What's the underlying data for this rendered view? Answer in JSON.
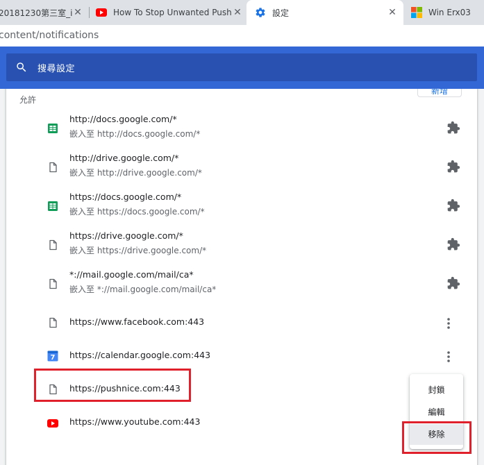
{
  "tabs": [
    {
      "title": "20181230第三室_i",
      "active": false
    },
    {
      "title": "How To Stop Unwanted Push",
      "active": false
    },
    {
      "title": "設定",
      "active": true
    },
    {
      "title": "Win Erx03",
      "active": false
    }
  ],
  "address_bar": {
    "url": "content/notifications"
  },
  "search": {
    "placeholder": "搜尋設定"
  },
  "section": {
    "label": "允許",
    "add_button": "新增"
  },
  "sites": [
    {
      "url": "http://docs.google.com/*",
      "sub": "嵌入至 http://docs.google.com/*",
      "icon": "google-sheets-icon",
      "action": "extension-icon"
    },
    {
      "url": "http://drive.google.com/*",
      "sub": "嵌入至 http://drive.google.com/*",
      "icon": "page-icon",
      "action": "extension-icon"
    },
    {
      "url": "https://docs.google.com/*",
      "sub": "嵌入至 https://docs.google.com/*",
      "icon": "google-sheets-icon",
      "action": "extension-icon"
    },
    {
      "url": "https://drive.google.com/*",
      "sub": "嵌入至 https://drive.google.com/*",
      "icon": "page-icon",
      "action": "extension-icon"
    },
    {
      "url": "*://mail.google.com/mail/ca*",
      "sub": "嵌入至 *://mail.google.com/mail/ca*",
      "icon": "page-icon",
      "action": "extension-icon"
    },
    {
      "url": "https://www.facebook.com:443",
      "icon": "page-icon",
      "action": "more-icon"
    },
    {
      "url": "https://calendar.google.com:443",
      "icon": "google-calendar-icon",
      "calendar_day": "7",
      "action": "more-icon"
    },
    {
      "url": "https://pushnice.com:443",
      "icon": "page-icon",
      "action": "none"
    },
    {
      "url": "https://www.youtube.com:443",
      "icon": "youtube-icon",
      "action": "none"
    }
  ],
  "menu": {
    "items": [
      "封鎖",
      "編輯",
      "移除"
    ],
    "highlighted": "移除"
  },
  "colors": {
    "header_blue": "#3367d6",
    "search_box": "#2851b1",
    "annotation_red": "#e0202a",
    "sheets_green": "#0f9d58",
    "youtube_red": "#ff0000",
    "calendar_blue": "#4285f4"
  }
}
